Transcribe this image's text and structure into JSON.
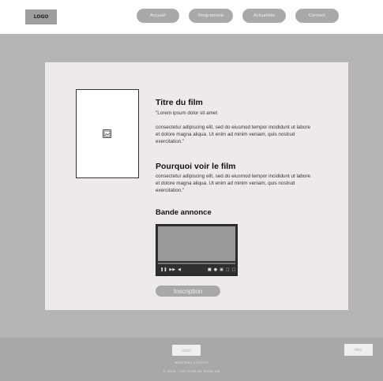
{
  "header": {
    "logo": "LOGO",
    "nav": [
      "Accueil",
      "Programme",
      "Actualités",
      "Contact"
    ]
  },
  "film": {
    "title": "Titre du film",
    "tagline": "\"Lorem ipsum dolor sit amet",
    "description": "consectetur adipiscing elit, sed do eiusmod tempor incididunt ut labore et dolore magna aliqua. Ut enim ad minim veniam, quis nostrud exercitation.\"",
    "why_title": "Pourquoi voir le film",
    "why_text": "consectetur adipiscing elit, sed do eiusmod tempor incididunt ut labore et dolore magna aliqua. Ut enim ad minim veniam, quis nostrud exercitation.\"",
    "trailer_title": "Bande annonce",
    "poster_icon": "image-placeholder-icon"
  },
  "player": {
    "controls": [
      "pause-icon",
      "skip-icon",
      "volume-icon",
      "settings-icon",
      "captions-icon",
      "pip-icon",
      "fullscreen-icon"
    ]
  },
  "cta": {
    "label": "Inscription"
  },
  "footer": {
    "logo": "LOGO",
    "button": "MAIL",
    "legal": "MENTIONS LÉGALES",
    "copyright": "© 2026 · LES FILMS DE PLEIN AIR"
  },
  "colors": {
    "page_bg": "#b5b5b5",
    "card_bg": "#eeeaea",
    "pill": "#a9a9a9",
    "footer_bg": "#a8a8a8"
  }
}
